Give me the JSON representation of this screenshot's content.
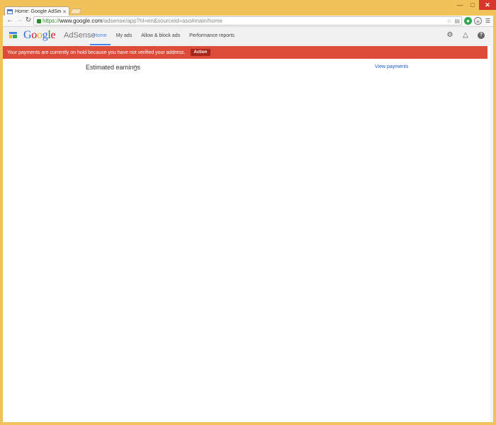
{
  "browser": {
    "tab_title": "Home: Google AdSense",
    "url_scheme": "https://",
    "url_host": "www.google.com",
    "url_path": "/adsense/app?hl=en&sourceid=aso#main/home"
  },
  "header": {
    "logo_letters": [
      "G",
      "o",
      "o",
      "g",
      "l",
      "e"
    ],
    "product": "AdSense",
    "nav": [
      {
        "label": "Home",
        "active": true
      },
      {
        "label": "My ads",
        "active": false
      },
      {
        "label": "Allow & block ads",
        "active": false
      },
      {
        "label": "Performance reports",
        "active": false
      }
    ]
  },
  "alert": {
    "message": "Your payments are currently on hold because you have not verified your address.",
    "action_label": "Action",
    "color": "#dd4b39"
  },
  "main": {
    "earnings_title": "Estimated earnings",
    "view_payments": "View payments"
  },
  "colors": {
    "accent": "#4285f4",
    "frame": "#f2c25a"
  }
}
